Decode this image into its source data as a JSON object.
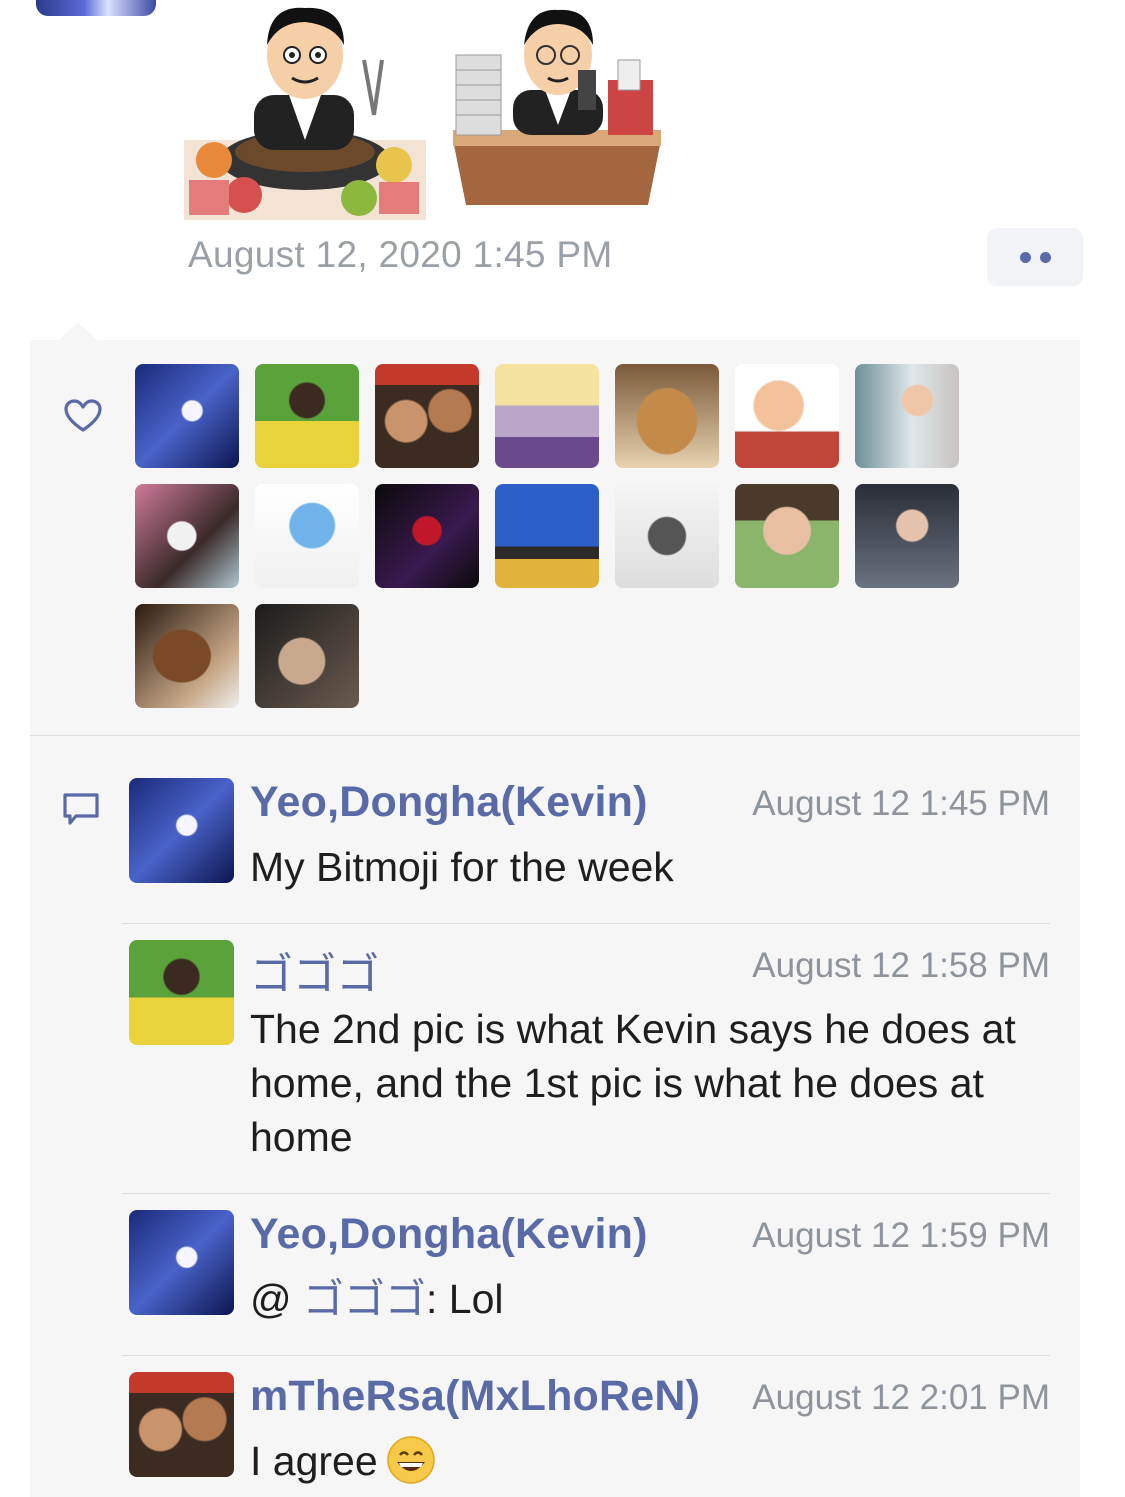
{
  "post": {
    "timestamp": "August 12, 2020 1:45 PM",
    "stickers": [
      "bitmoji-bbq-sticker",
      "bitmoji-desk-work-sticker"
    ],
    "more_icon": "more-dots-icon"
  },
  "reactions": {
    "icon": "heart-icon",
    "count": 16
  },
  "comments_icon": "comment-icon",
  "comments": [
    {
      "author": "Yeo,Dongha(Kevin)",
      "time": "August 12 1:45 PM",
      "text": "My Bitmoji for the week"
    },
    {
      "author": "ゴゴゴ",
      "time": "August 12 1:58 PM",
      "text": "The 2nd pic is what Kevin says he does at home, and the 1st pic is what he does at home"
    },
    {
      "author": "Yeo,Dongha(Kevin)",
      "time": "August 12 1:59 PM",
      "mention_prefix": "@ ",
      "mention": "ゴゴゴ",
      "text_after_mention": ": Lol"
    },
    {
      "author": "mTheRsa(MxLhoReN)",
      "time": "August 12 2:01 PM",
      "text": "I agree",
      "emoji": "grinning-face-emoji"
    }
  ]
}
